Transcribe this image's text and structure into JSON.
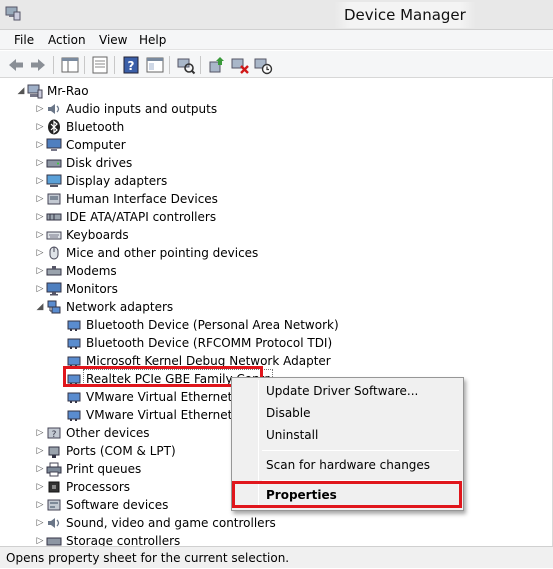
{
  "window": {
    "title": "Device Manager"
  },
  "menubar": {
    "items": [
      "File",
      "Action",
      "View",
      "Help"
    ]
  },
  "toolbar": {
    "buttons": [
      "back-icon",
      "forward-icon",
      "show-hide-console-tree-icon",
      "properties-icon",
      "help-icon",
      "view-pane-icon",
      "scan-hardware-icon",
      "update-driver-icon",
      "uninstall-icon",
      "disable-icon"
    ]
  },
  "tree": {
    "root": "Mr-Rao",
    "categories": [
      {
        "label": "Audio inputs and outputs",
        "icon": "speaker-icon",
        "expanded": false
      },
      {
        "label": "Bluetooth",
        "icon": "bluetooth-icon",
        "expanded": false
      },
      {
        "label": "Computer",
        "icon": "computer-icon",
        "expanded": false
      },
      {
        "label": "Disk drives",
        "icon": "disk-drive-icon",
        "expanded": false
      },
      {
        "label": "Display adapters",
        "icon": "display-adapter-icon",
        "expanded": false
      },
      {
        "label": "Human Interface Devices",
        "icon": "hid-icon",
        "expanded": false
      },
      {
        "label": "IDE ATA/ATAPI controllers",
        "icon": "ide-controller-icon",
        "expanded": false
      },
      {
        "label": "Keyboards",
        "icon": "keyboard-icon",
        "expanded": false
      },
      {
        "label": "Mice and other pointing devices",
        "icon": "mouse-icon",
        "expanded": false
      },
      {
        "label": "Modems",
        "icon": "modem-icon",
        "expanded": false
      },
      {
        "label": "Monitors",
        "icon": "monitor-icon",
        "expanded": false
      },
      {
        "label": "Network adapters",
        "icon": "network-adapter-icon",
        "expanded": true
      }
    ],
    "network_children": [
      "Bluetooth Device (Personal Area Network)",
      "Bluetooth Device (RFCOMM Protocol TDI)",
      "Microsoft Kernel Debug Network Adapter",
      "Realtek PCIe GBE Family Controller",
      "VMware Virtual Ethernet Adapter for VMnet1",
      "VMware Virtual Ethernet Adapter for VMnet8"
    ],
    "network_children_visible": [
      "Bluetooth Device (Personal Area Network)",
      "Bluetooth Device (RFCOMM Protocol TDI)",
      "Microsoft Kernel Debug Network Adapter",
      "Realtek PCIe GBE Family Contr",
      "VMware Virtual Ethernet Ad",
      "VMware Virtual Ethernet Ad"
    ],
    "categories_after": [
      {
        "label": "Other devices",
        "icon": "other-devices-icon"
      },
      {
        "label": "Ports (COM & LPT)",
        "icon": "port-icon"
      },
      {
        "label": "Print queues",
        "icon": "printer-icon"
      },
      {
        "label": "Processors",
        "icon": "processor-icon"
      },
      {
        "label": "Software devices",
        "icon": "software-device-icon"
      },
      {
        "label": "Sound, video and game controllers",
        "icon": "sound-icon"
      },
      {
        "label": "Storage controllers",
        "icon": "storage-controller-icon"
      }
    ]
  },
  "context_menu": {
    "items": [
      "Update Driver Software...",
      "Disable",
      "Uninstall",
      "Scan for hardware changes",
      "Properties"
    ],
    "default_item": "Properties"
  },
  "statusbar": {
    "text": "Opens property sheet for the current selection."
  },
  "colors": {
    "highlight_box": "#e0161c",
    "menu_bg": "#f0f0f0",
    "titlebar_bg": "#e8e8e8"
  }
}
